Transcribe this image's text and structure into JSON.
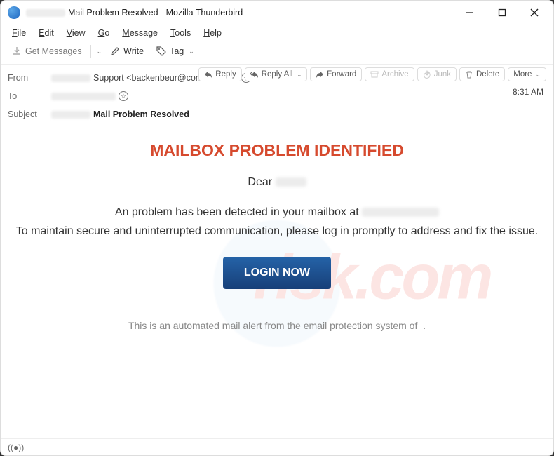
{
  "window": {
    "title": "Mail Problem Resolved - Mozilla Thunderbird"
  },
  "menu": {
    "file": "ile",
    "edit": "dit",
    "view": "iew",
    "go": "o",
    "message": "essage",
    "tools": "ools",
    "help": "elp"
  },
  "toolbar": {
    "get_messages": "Get Messages",
    "write": "Write",
    "tag": "Tag"
  },
  "headers": {
    "from_label": "From",
    "from_value": "Support <backenbeur@contetele.co>",
    "to_label": "To",
    "subject_label": "Subject",
    "subject_value": "Mail Problem Resolved",
    "time": "8:31 AM"
  },
  "actions": {
    "reply": "Reply",
    "reply_all": "Reply All",
    "forward": "Forward",
    "archive": "Archive",
    "junk": "Junk",
    "delete": "Delete",
    "more": "More"
  },
  "email": {
    "heading": "MAILBOX PROBLEM IDENTIFIED",
    "greeting": "Dear",
    "line1": "An problem has been detected in your mailbox at",
    "line2": "To maintain secure and uninterrupted communication, please log in promptly to address and fix the issue.",
    "cta": "LOGIN NOW",
    "footer": "This is an automated mail alert from the email protection system of"
  },
  "watermark": {
    "text": "risk.com"
  }
}
